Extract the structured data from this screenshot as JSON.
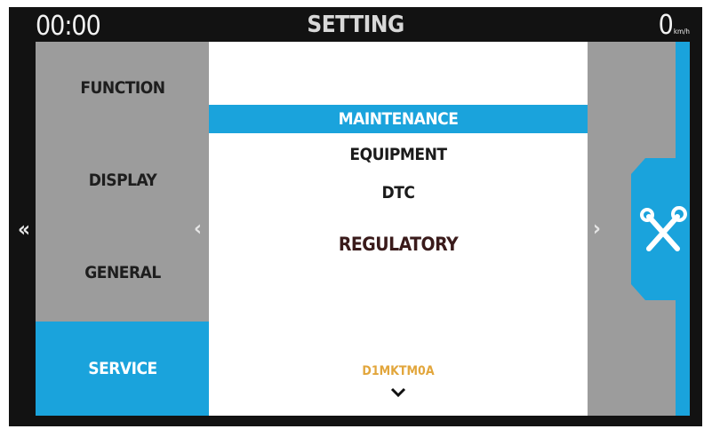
{
  "topbar": {
    "clock": "00:00",
    "title": "SETTING",
    "speed_value": "0",
    "speed_unit": "km/h"
  },
  "sidebar": {
    "items": [
      {
        "label": "FUNCTION",
        "active": false
      },
      {
        "label": "DISPLAY",
        "active": false
      },
      {
        "label": "GENERAL",
        "active": false
      },
      {
        "label": "SERVICE",
        "active": true
      }
    ]
  },
  "menu": {
    "items": [
      {
        "label": "MAINTENANCE",
        "selected": true
      },
      {
        "label": "EQUIPMENT",
        "selected": false
      },
      {
        "label": "DTC",
        "selected": false
      },
      {
        "label": "REGULATORY",
        "selected": false
      }
    ],
    "version_code": "D1MKTM0A"
  },
  "icons": {
    "back": "double-chevron-left-icon",
    "prev": "chevron-left-icon",
    "next": "chevron-right-icon",
    "more": "chevron-down-icon",
    "service": "tools-icon"
  },
  "colors": {
    "accent": "#1aa3dc",
    "panel": "#9c9c9c",
    "background": "#121212",
    "version_code": "#e2a63c"
  }
}
